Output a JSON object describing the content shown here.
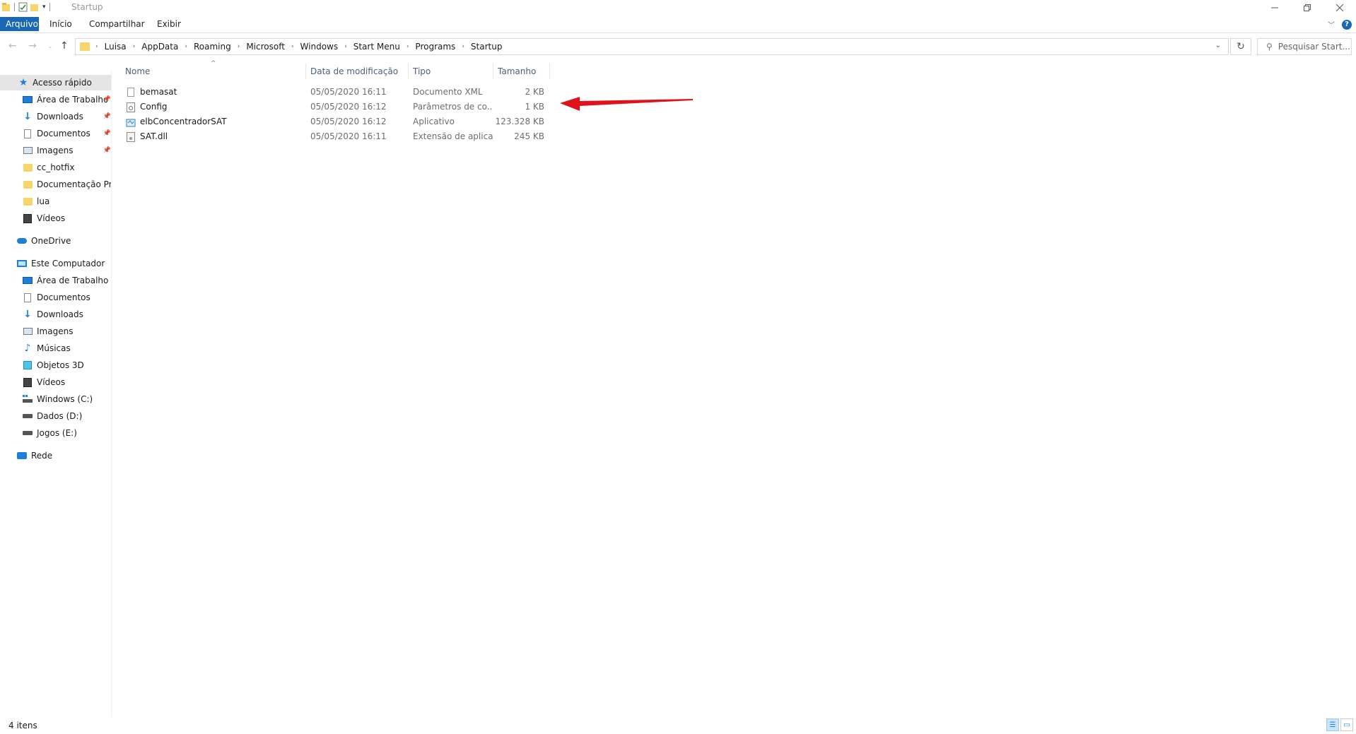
{
  "window": {
    "title": "Startup"
  },
  "ribbon": {
    "tabs": [
      "Arquivo",
      "Início",
      "Compartilhar",
      "Exibir"
    ]
  },
  "address": {
    "crumbs": [
      "Luisa",
      "AppData",
      "Roaming",
      "Microsoft",
      "Windows",
      "Start Menu",
      "Programs",
      "Startup"
    ],
    "search_placeholder": "Pesquisar Start..."
  },
  "sidebar": {
    "quick_access": "Acesso rápido",
    "quick_items": [
      {
        "label": "Área de Trabalho",
        "icon": "desktop-icon",
        "pinned": true
      },
      {
        "label": "Downloads",
        "icon": "download-icon",
        "pinned": true
      },
      {
        "label": "Documentos",
        "icon": "documents-icon",
        "pinned": true
      },
      {
        "label": "Imagens",
        "icon": "pictures-icon",
        "pinned": true
      },
      {
        "label": "cc_hotfix",
        "icon": "folder-icon",
        "pinned": false
      },
      {
        "label": "Documentação Pres",
        "icon": "folder-icon",
        "pinned": false
      },
      {
        "label": "lua",
        "icon": "folder-icon",
        "pinned": false
      },
      {
        "label": "Vídeos",
        "icon": "videos-icon",
        "pinned": false
      }
    ],
    "onedrive": "OneDrive",
    "this_pc": "Este Computador",
    "pc_items": [
      {
        "label": "Área de Trabalho",
        "icon": "desktop-icon"
      },
      {
        "label": "Documentos",
        "icon": "documents-icon"
      },
      {
        "label": "Downloads",
        "icon": "download-icon"
      },
      {
        "label": "Imagens",
        "icon": "pictures-icon"
      },
      {
        "label": "Músicas",
        "icon": "music-icon"
      },
      {
        "label": "Objetos 3D",
        "icon": "3d-objects-icon"
      },
      {
        "label": "Vídeos",
        "icon": "videos-icon"
      },
      {
        "label": "Windows (C:)",
        "icon": "windows-drive-icon"
      },
      {
        "label": "Dados (D:)",
        "icon": "drive-icon"
      },
      {
        "label": "Jogos (E:)",
        "icon": "drive-icon"
      }
    ],
    "network": "Rede"
  },
  "file_list": {
    "columns": [
      "Nome",
      "Data de modificação",
      "Tipo",
      "Tamanho"
    ],
    "rows": [
      {
        "name": "bemasat",
        "date": "05/05/2020 16:11",
        "type": "Documento XML",
        "size": "2 KB",
        "icon": "xml-file-icon"
      },
      {
        "name": "Config",
        "date": "05/05/2020 16:12",
        "type": "Parâmetros de co...",
        "size": "1 KB",
        "icon": "config-file-icon"
      },
      {
        "name": "elbConcentradorSAT",
        "date": "05/05/2020 16:12",
        "type": "Aplicativo",
        "size": "123.328 KB",
        "icon": "application-icon"
      },
      {
        "name": "SAT.dll",
        "date": "05/05/2020 16:11",
        "type": "Extensão de aplica...",
        "size": "245 KB",
        "icon": "dll-file-icon"
      }
    ]
  },
  "annotation": {
    "color": "#e0121b"
  },
  "status": {
    "item_count": "4 itens"
  },
  "colors": {
    "accent": "#1a68b3",
    "folder": "#f7d56b",
    "selection": "#e5e5e5"
  }
}
